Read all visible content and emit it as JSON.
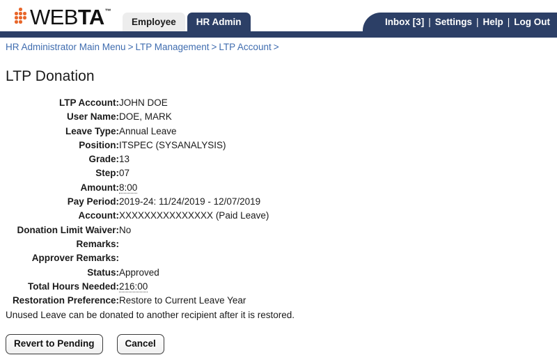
{
  "brand": {
    "name_light": "WEB",
    "name_bold": "TA",
    "trademark": "™",
    "dot_color": "#E8662A",
    "navy": "#2C3F66"
  },
  "tabs": [
    {
      "label": "Employee",
      "active": false
    },
    {
      "label": "HR Admin",
      "active": true
    }
  ],
  "topnav": {
    "inbox": "Inbox [3]",
    "settings": "Settings",
    "help": "Help",
    "logout": "Log Out",
    "separator": "|"
  },
  "breadcrumb": {
    "separator": ">",
    "items": [
      "HR Administrator Main Menu",
      "LTP Management",
      "LTP Account"
    ]
  },
  "page": {
    "title": "LTP Donation",
    "note": "Unused Leave can be donated to another recipient after it is restored."
  },
  "details": [
    {
      "label": "LTP Account:",
      "value": "JOHN DOE",
      "dotted": false
    },
    {
      "label": "User Name:",
      "value": "DOE, MARK",
      "dotted": false
    },
    {
      "label": "Leave Type:",
      "value": "Annual Leave",
      "dotted": false
    },
    {
      "label": "Position:",
      "value": "ITSPEC (SYSANALYSIS)",
      "dotted": false
    },
    {
      "label": "Grade:",
      "value": "13",
      "dotted": false
    },
    {
      "label": "Step:",
      "value": "07",
      "dotted": false
    },
    {
      "label": "Amount:",
      "value": "8:00",
      "dotted": true
    },
    {
      "label": "Pay Period:",
      "value": "2019-24: 11/24/2019 - 12/07/2019",
      "dotted": false
    },
    {
      "label": "Account:",
      "value": "XXXXXXXXXXXXXXX (Paid Leave)",
      "dotted": false
    },
    {
      "label": "Donation Limit Waiver:",
      "value": "No",
      "dotted": false
    },
    {
      "label": "Remarks:",
      "value": "",
      "dotted": false
    },
    {
      "label": "Approver Remarks:",
      "value": "",
      "dotted": false
    },
    {
      "label": "Status:",
      "value": "Approved",
      "dotted": false
    },
    {
      "label": "Total Hours Needed:",
      "value": "216:00",
      "dotted": true
    },
    {
      "label": "Restoration Preference:",
      "value": "Restore to Current Leave Year",
      "dotted": false
    }
  ],
  "buttons": {
    "revert": "Revert to Pending",
    "cancel": "Cancel"
  }
}
